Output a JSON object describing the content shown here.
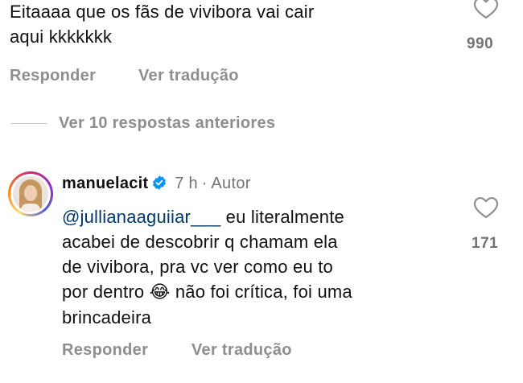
{
  "top_comment": {
    "line1": "Eitaaaa que os fãs de vivibora vai cair",
    "line2": "aqui kkkkkkk",
    "likes": "990",
    "reply_label": "Responder",
    "translate_label": "Ver tradução"
  },
  "view_replies": {
    "label": "Ver 10 respostas anteriores"
  },
  "reply": {
    "username": "manuelacit",
    "time": "7 h",
    "separator": "·",
    "author_tag": "Autor",
    "mention": "@jullianaaguiiar___",
    "line1_rest": " eu literalmente",
    "line2": "acabei de descobrir q chamam ela",
    "line3": "de vivibora, pra vc ver como eu to",
    "line4_pre": "por dentro ",
    "emoji": "😂",
    "line4_post": " não foi crítica, foi uma",
    "line5": "brincadeira",
    "likes": "171",
    "reply_label": "Responder",
    "translate_label": "Ver tradução"
  },
  "colors": {
    "text": "#111111",
    "muted": "#8e8e8e",
    "mention": "#00376b",
    "verified": "#0095f6",
    "story_ring": "#d6249f"
  },
  "icons": [
    "heart-icon",
    "verified-badge-icon",
    "avatar"
  ]
}
